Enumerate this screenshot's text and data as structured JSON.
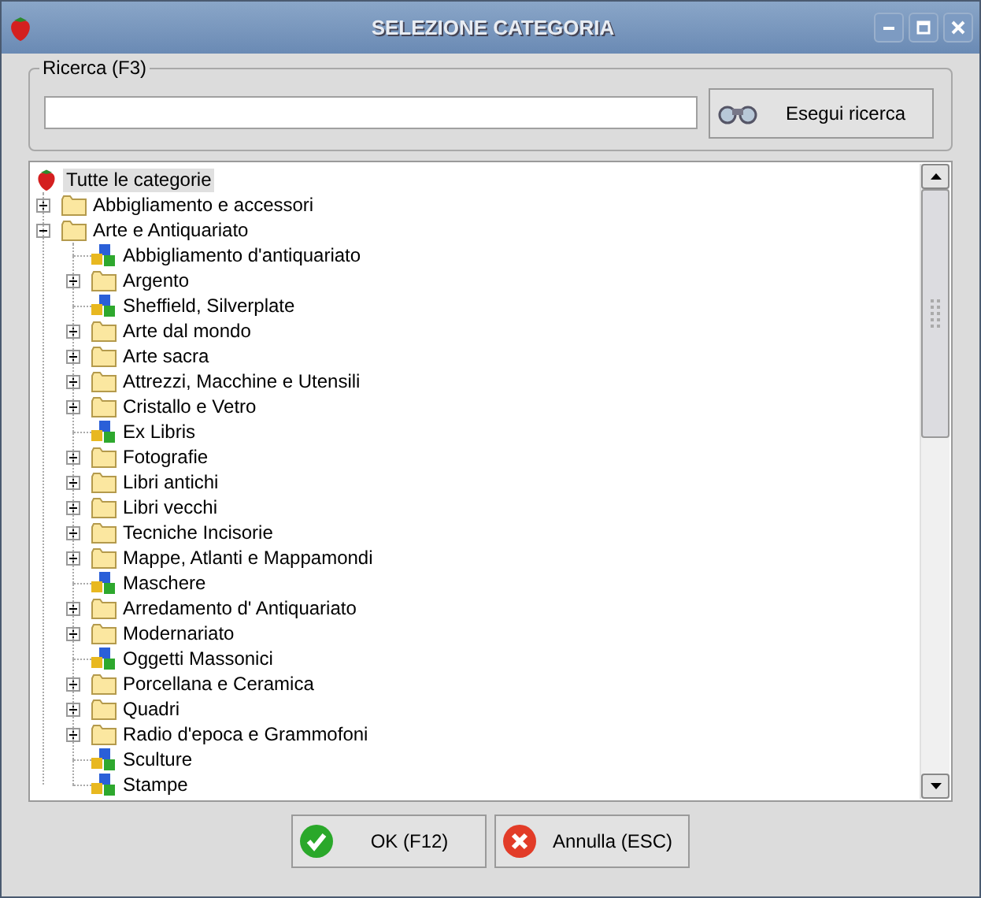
{
  "window": {
    "title": "SELEZIONE CATEGORIA"
  },
  "search": {
    "label": "Ricerca (F3)",
    "button": "Esegui ricerca"
  },
  "tree": {
    "label": "Tutte le categorie",
    "kind": "root",
    "selected": true,
    "children": [
      {
        "label": "Abbigliamento e accessori",
        "kind": "folder",
        "selected": false,
        "expanded": false
      },
      {
        "label": "Arte e Antiquariato",
        "kind": "folder",
        "selected": false,
        "expanded": true,
        "children": [
          {
            "label": "Abbigliamento d'antiquariato",
            "kind": "leaf",
            "selected": false
          },
          {
            "label": "Argento",
            "kind": "folder",
            "selected": false,
            "expanded": false
          },
          {
            "label": "Sheffield, Silverplate",
            "kind": "leaf",
            "selected": false
          },
          {
            "label": "Arte dal mondo",
            "kind": "folder",
            "selected": false,
            "expanded": false
          },
          {
            "label": "Arte sacra",
            "kind": "folder",
            "selected": false,
            "expanded": false
          },
          {
            "label": "Attrezzi, Macchine e Utensili",
            "kind": "folder",
            "selected": false,
            "expanded": false
          },
          {
            "label": "Cristallo e Vetro",
            "kind": "folder",
            "selected": false,
            "expanded": false
          },
          {
            "label": "Ex Libris",
            "kind": "leaf",
            "selected": false
          },
          {
            "label": "Fotografie",
            "kind": "folder",
            "selected": false,
            "expanded": false
          },
          {
            "label": "Libri antichi",
            "kind": "folder",
            "selected": false,
            "expanded": false
          },
          {
            "label": "Libri vecchi",
            "kind": "folder",
            "selected": false,
            "expanded": false
          },
          {
            "label": "Tecniche Incisorie",
            "kind": "folder",
            "selected": false,
            "expanded": false
          },
          {
            "label": "Mappe, Atlanti e Mappamondi",
            "kind": "folder",
            "selected": false,
            "expanded": false
          },
          {
            "label": "Maschere",
            "kind": "leaf",
            "selected": false
          },
          {
            "label": "Arredamento d' Antiquariato",
            "kind": "folder",
            "selected": false,
            "expanded": false
          },
          {
            "label": "Modernariato",
            "kind": "folder",
            "selected": false,
            "expanded": false
          },
          {
            "label": "Oggetti Massonici",
            "kind": "leaf",
            "selected": false
          },
          {
            "label": "Porcellana e Ceramica",
            "kind": "folder",
            "selected": false,
            "expanded": false
          },
          {
            "label": "Quadri",
            "kind": "folder",
            "selected": false,
            "expanded": false
          },
          {
            "label": "Radio d'epoca e Grammofoni",
            "kind": "folder",
            "selected": false,
            "expanded": false
          },
          {
            "label": "Sculture",
            "kind": "leaf",
            "selected": false
          },
          {
            "label": "Stampe",
            "kind": "leaf",
            "selected": false
          }
        ]
      }
    ]
  },
  "buttons": [
    {
      "label": "OK (F12)",
      "kind": "ok"
    },
    {
      "label": "Annulla (ESC)",
      "kind": "cancel"
    }
  ]
}
